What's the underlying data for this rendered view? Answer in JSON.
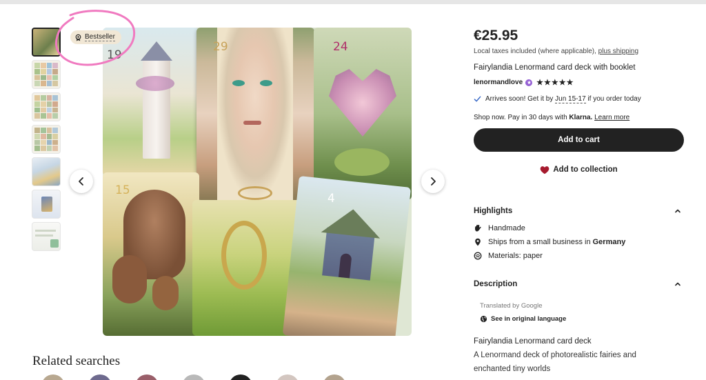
{
  "gallery": {
    "badge": "Bestseller",
    "card_numbers": [
      "19",
      "29",
      "24",
      "15",
      "4"
    ],
    "prev_icon": "chevron-left-icon",
    "next_icon": "chevron-right-icon"
  },
  "related": {
    "title": "Related searches"
  },
  "product": {
    "price": "€25.95",
    "tax_note": "Local taxes included (where applicable),",
    "shipping_link": "plus shipping",
    "title": "Fairylandia Lenormand card deck with booklet",
    "shop_name": "lenormandlove",
    "stars": "★★★★★",
    "arrives_prefix": "Arrives soon! Get it by",
    "arrives_dates": "Jun 15-17",
    "arrives_suffix": "if you order today",
    "klarna_prefix": "Shop now. Pay in 30 days with",
    "klarna_brand": "Klarna.",
    "klarna_link": "Learn more",
    "add_to_cart": "Add to cart",
    "add_to_collection": "Add to collection"
  },
  "highlights": {
    "title": "Highlights",
    "items": [
      {
        "icon": "hand-icon",
        "text": "Handmade"
      },
      {
        "icon": "location-pin-icon",
        "text_prefix": "Ships from a small business in",
        "text_bold": "Germany"
      },
      {
        "icon": "materials-icon",
        "text": "Materials: paper"
      }
    ]
  },
  "description": {
    "title": "Description",
    "translated": "Translated by Google",
    "original_language": "See in original language",
    "lines": [
      "Fairylandia Lenormand card deck",
      "A Lenormand deck of photorealistic fairies and",
      "enchanted tiny worlds"
    ]
  },
  "colors": {
    "button_dark": "#222222",
    "heart_red": "#a61a2e",
    "badge_bg": "#f1e7d5",
    "annotation_pink": "#f07ac0",
    "star_seller_purple": "#9560d4"
  }
}
